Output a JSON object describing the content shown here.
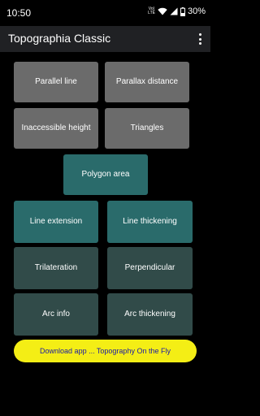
{
  "status_bar": {
    "time": "10:50",
    "volte_top": "Vo)",
    "volte_bottom": "LTE",
    "battery_text": "30%",
    "icons": [
      "volte-icon",
      "wifi-icon",
      "cell-signal-icon",
      "battery-icon"
    ]
  },
  "app_bar": {
    "title": "Topographia Classic",
    "menu_icon": "overflow-menu-icon"
  },
  "buttons": {
    "parallel_line": "Parallel line",
    "parallax_distance": "Parallax distance",
    "inaccessible_height": "Inaccessible height",
    "triangles": "Triangles",
    "polygon_area": "Polygon area",
    "line_extension": "Line extension",
    "line_thickening": "Line thickening",
    "trilateration": "Trilateration",
    "perpendicular": "Perpendicular",
    "arc_info": "Arc info",
    "arc_thickening": "Arc thickening"
  },
  "download_banner": {
    "label": "Download app ... Topography On the Fly"
  },
  "colors": {
    "background": "#000000",
    "app_bar": "#202124",
    "gray_button": "#6b6b6b",
    "teal_button": "#2a6b6b",
    "dark_teal_button": "#314b49",
    "banner_bg": "#f4ee15",
    "banner_text": "#1a1aa8"
  }
}
